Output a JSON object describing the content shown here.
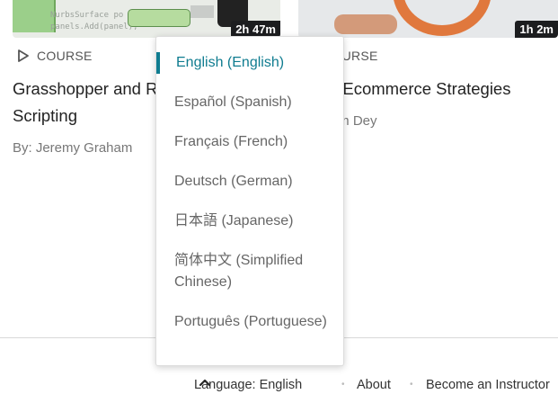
{
  "courses": [
    {
      "type_label": "COURSE",
      "duration": "2h 47m",
      "title": "Grasshopper and Rhino C# Scripting",
      "author": "By: Jeremy Graham",
      "thumb_code": [
        "NurbsSurface po",
        "panels.Add(panel);"
      ]
    },
    {
      "type_label": "COURSE",
      "duration": "1h 2m",
      "title": "SEO: Ecommerce Strategies",
      "author": "By: Sam Dey"
    }
  ],
  "language_menu": {
    "items": [
      {
        "label": "English (English)",
        "active": true
      },
      {
        "label": "Español (Spanish)",
        "active": false
      },
      {
        "label": "Français (French)",
        "active": false
      },
      {
        "label": "Deutsch (German)",
        "active": false
      },
      {
        "label": "日本語 (Japanese)",
        "active": false
      },
      {
        "label": "简体中文 (Simplified Chinese)",
        "active": false
      },
      {
        "label": "Português (Portuguese)",
        "active": false
      }
    ]
  },
  "footer": {
    "language_label": "Language: English",
    "separator": "•",
    "about": "About",
    "become_instructor": "Become an Instructor"
  },
  "colors": {
    "accent": "#0f7c90",
    "duration_badge": "#1c1d1f"
  }
}
